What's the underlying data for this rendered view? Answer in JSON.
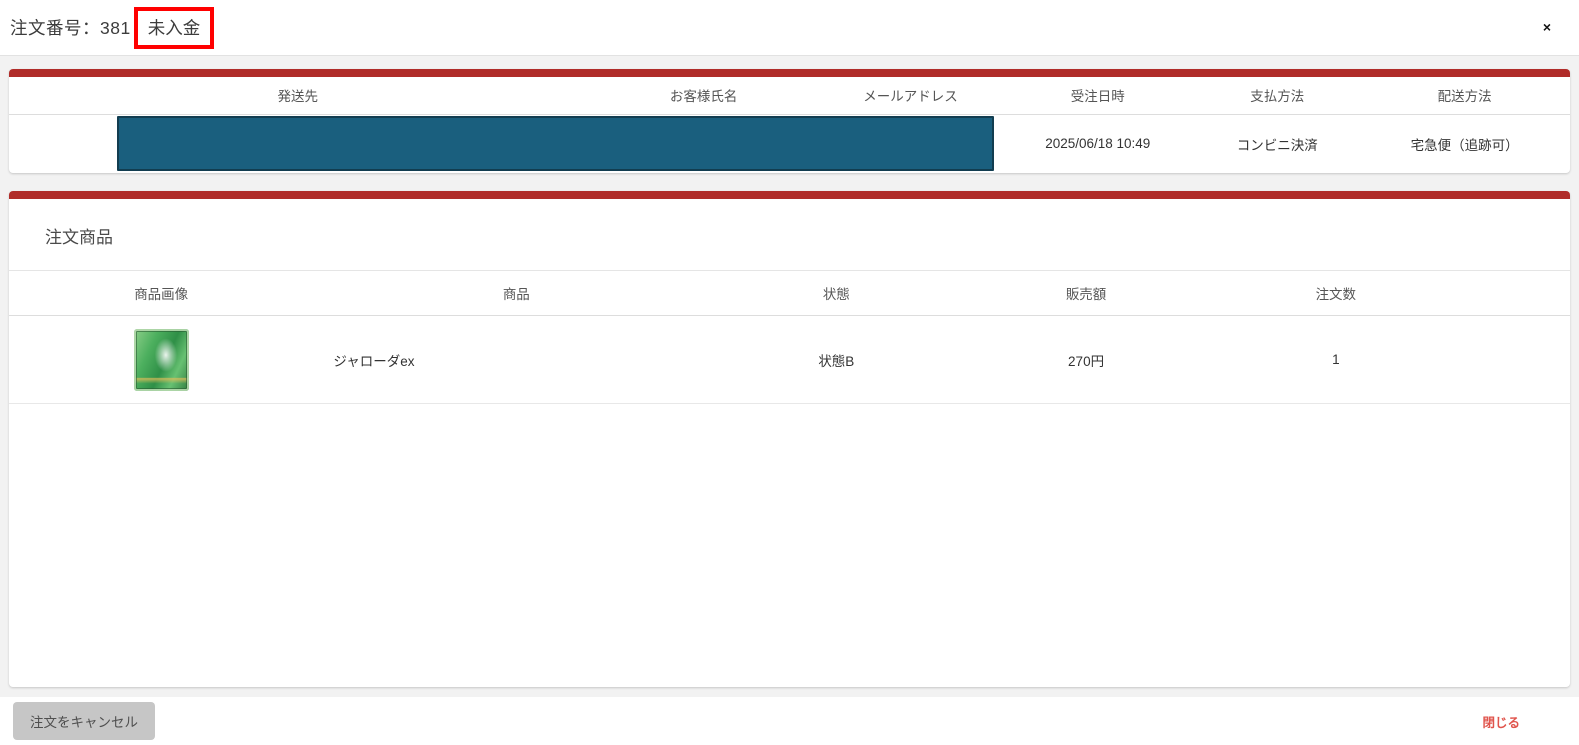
{
  "modal": {
    "title_label": "注文番号：381",
    "status_badge": "未入金",
    "close_x": "×"
  },
  "order_info": {
    "headers": [
      "発送先",
      "お客様氏名",
      "メールアドレス",
      "受注日時",
      "支払方法",
      "配送方法"
    ],
    "row": {
      "order_datetime": "2025/06/18 10:49",
      "payment_method": "コンビニ決済",
      "shipping_method": "宅急便（追跡可）"
    },
    "redacted_fields_note": ""
  },
  "order_items": {
    "section_title": "注文商品",
    "headers": [
      "商品画像",
      "商品",
      "状態",
      "販売額",
      "注文数"
    ],
    "rows": [
      {
        "product_name": "ジャローダex",
        "condition": "状態B",
        "price": "270円",
        "quantity": "1"
      }
    ]
  },
  "footer": {
    "cancel_button_label": "注文をキャンセル",
    "close_link_label": "閉じる"
  },
  "colors": {
    "accent_red_bar": "#b02c29",
    "annotation_red": "#ff0000",
    "redaction_fill": "#1a5f7e",
    "redaction_border": "#123d50",
    "close_link_red": "#e0544c",
    "body_gray": "#f2f2f2"
  }
}
